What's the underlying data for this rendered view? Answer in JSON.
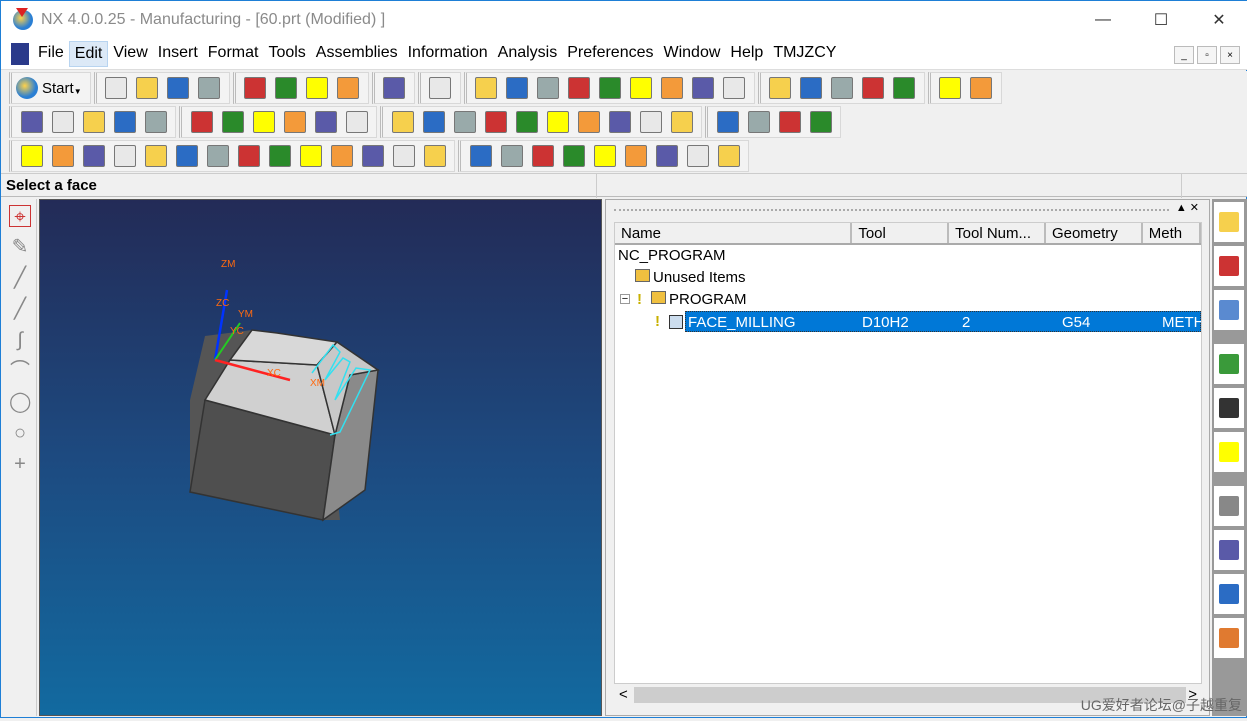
{
  "window": {
    "title": "NX 4.0.0.25 - Manufacturing - [60.prt (Modified) ]",
    "minimize": "—",
    "maximize": "☐",
    "close": "✕"
  },
  "menubar": {
    "items": [
      "File",
      "Edit",
      "View",
      "Insert",
      "Format",
      "Tools",
      "Assemblies",
      "Information",
      "Analysis",
      "Preferences",
      "Window",
      "Help",
      "TMJZCY"
    ],
    "active": "Edit",
    "mdi": [
      "_",
      "▫",
      "×"
    ]
  },
  "toolbar": {
    "start_label": "Start",
    "row1": [
      [
        "new-icon",
        "open-icon",
        "save-icon",
        "print-icon"
      ],
      [
        "cut-icon",
        "copy-icon",
        "paste-icon",
        "delete-icon"
      ],
      [
        "undo-icon"
      ],
      [
        "information-icon"
      ],
      [
        "fit-icon",
        "shaded-icon",
        "zoom-window-icon",
        "zoom-icon",
        "rotate-icon",
        "pan-icon",
        "wireframe-icon",
        "view-cube-icon",
        "display-mode-icon"
      ],
      [
        "wcs-icon",
        "orient-icon",
        "color-icon",
        "hide-icon",
        "show-icon"
      ],
      [
        "measure-distance-icon",
        "measure-angle-icon"
      ]
    ],
    "row2": [
      [
        "create-program-icon",
        "create-tool-icon",
        "create-geometry-icon",
        "create-method-icon",
        "create-operation-icon"
      ],
      [
        "edit-object-icon",
        "cut-object-icon",
        "copy-object-icon",
        "paste-object-icon",
        "delete-object-icon",
        "display-object-icon"
      ],
      [
        "generate-toolpath-icon",
        "replay-icon",
        "list-toolpath-icon",
        "verify-icon",
        "machine-simulate-icon",
        "postprocess-icon",
        "output-cls-icon",
        "workpiece-icon",
        "shop-docs-icon",
        "time-icon"
      ],
      [
        "program-view-icon",
        "tool-view-icon",
        "geometry-view-icon",
        "method-view-icon"
      ]
    ],
    "row3": [
      [
        "transform-icon",
        "object-origin-icon",
        "rotate-90-icon",
        "power-icon",
        "rename-abc-icon",
        "spring-icon",
        "rename-cn-icon",
        "no-name-icon",
        "brush-icon",
        "glasses-icon",
        "tool-shape-icon",
        "notes-icon",
        "plane-icon",
        "plane2-icon"
      ],
      [
        "block-icon",
        "layers-icon",
        "color-block-icon",
        "hand-icon",
        "solid-icon",
        "frame-icon",
        "frame2-icon",
        "printer-icon",
        "a4-icon"
      ]
    ],
    "colors": [
      "#e8e8e8",
      "#f6d04d",
      "#2b6cc4",
      "#9aa",
      "#c33",
      "#2a8a2a",
      "#ffff00",
      "#f39a3a",
      "#5a5aa8"
    ]
  },
  "status": {
    "prompt": "Select a face"
  },
  "left_toolbar": {
    "tools": [
      "select-face-icon",
      "snap-icon",
      "line-icon",
      "line2-icon",
      "spline-icon",
      "arc-icon",
      "circle-icon",
      "circle2-icon",
      "point-icon"
    ]
  },
  "viewport": {
    "labels": {
      "zm": "ZM",
      "zc": "ZC",
      "ym": "YM",
      "yc": "YC",
      "xc": "XC",
      "xm": "XM"
    }
  },
  "navigator": {
    "columns": [
      "Name",
      "Tool",
      "Tool Num...",
      "Geometry",
      "Meth"
    ],
    "root": "NC_PROGRAM",
    "unused": "Unused Items",
    "program": "PROGRAM",
    "operation": {
      "name": "FACE_MILLING",
      "tool": "D10H2",
      "tool_number": "2",
      "geometry": "G54",
      "method": "METH"
    },
    "collapse": "−",
    "scroll_left": "<",
    "scroll_right": ">"
  },
  "resource_bar": {
    "tabs": [
      "operation-navigator-icon",
      "machine-tool-navigator-icon",
      "part-navigator-icon",
      "web-browser-icon",
      "training-icon",
      "help-icon",
      "history-icon",
      "palette-icon",
      "system-material-icon",
      "roles-icon"
    ]
  },
  "watermark": "UG爱好者论坛@子越重复"
}
